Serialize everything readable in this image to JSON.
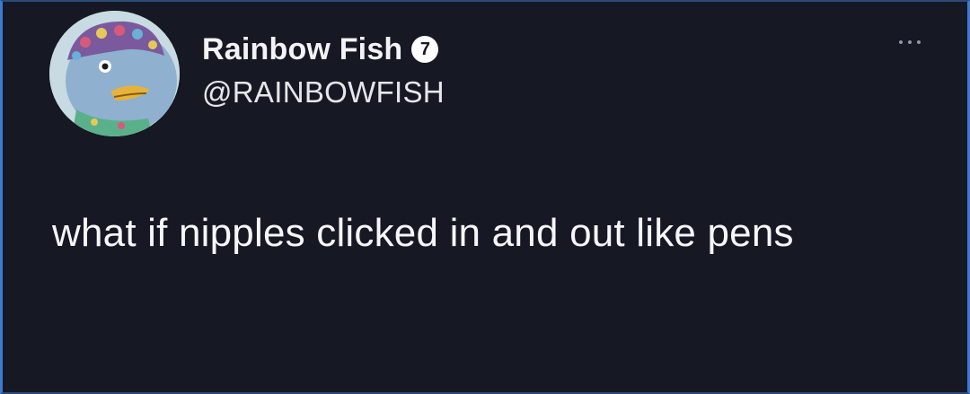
{
  "tweet": {
    "display_name": "Rainbow Fish",
    "verified_badge": "7",
    "handle": "@RAINBOWFISH",
    "text": "what if nipples clicked in and out like pens",
    "more_icon": "ellipsis-icon",
    "avatar_icon": "fish-avatar"
  },
  "colors": {
    "background": "#161824",
    "text": "#f5f6f8",
    "frame_accent": "#3a7bd5"
  }
}
